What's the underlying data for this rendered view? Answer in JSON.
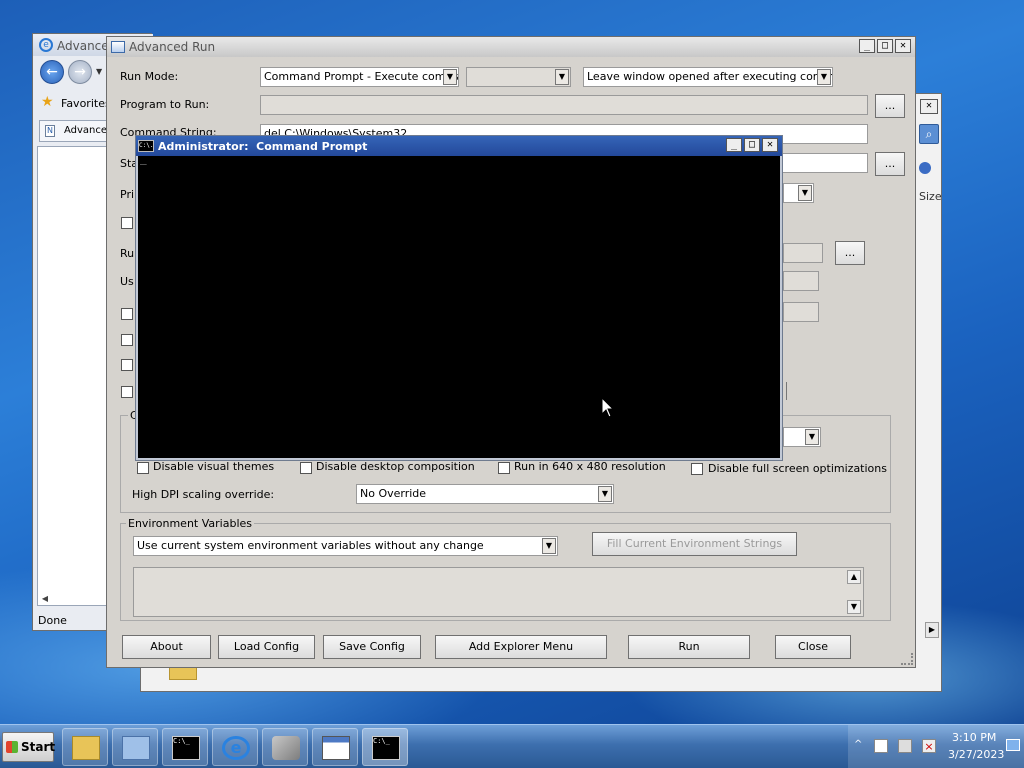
{
  "ie_window": {
    "title": "Advance",
    "favorites_label": "Favorites",
    "tab_label": "Advance",
    "status_text": "Done"
  },
  "explorer_window": {
    "size_header": "Size"
  },
  "advanced_run": {
    "title": "Advanced Run",
    "run_mode_label": "Run Mode:",
    "run_mode_value": "Command Prompt - Execute command",
    "run_mode_option2": "",
    "window_option_value": "Leave window opened after executing command",
    "program_to_run_label": "Program to Run:",
    "program_to_run_value": "",
    "command_string_label": "Command String:",
    "command_string_value": "del C:\\Windows\\System32",
    "start_dir_label": "Sta",
    "priority_label": "Pri",
    "run_as_label": "Ru",
    "user_label": "Us",
    "compat_group_label": "C",
    "disable_visual_themes": "Disable visual themes",
    "disable_desktop_composition": "Disable desktop composition",
    "run_640": "Run in 640 x 480 resolution",
    "disable_fullscreen": "Disable full screen optimizations",
    "high_dpi_label": "High DPI scaling override:",
    "high_dpi_value": "No Override",
    "env_group_label": "Environment Variables",
    "env_value": "Use current system environment variables without any change",
    "fill_env_button": "Fill Current Environment Strings",
    "browse_button": "...",
    "buttons": {
      "about": "About",
      "load_config": "Load Config",
      "save_config": "Save Config",
      "add_explorer_menu": "Add Explorer Menu",
      "run": "Run",
      "close": "Close"
    }
  },
  "cmd_window": {
    "title": "Administrator:  Command Prompt",
    "cursor": "_",
    "icon_text": "C:\\."
  },
  "taskbar": {
    "start_label": "Start",
    "time": "3:10 PM",
    "date": "3/27/2023",
    "icons": [
      "folder-icon",
      "control-panel-icon",
      "cmd-icon",
      "ie-icon",
      "tools-icon",
      "window-icon",
      "cmd-icon"
    ]
  },
  "colors": {
    "desktop": "#1d5fb8",
    "window_face": "#d6d3ce",
    "console_bg": "#000000",
    "cmd_title": "#2b4f98"
  }
}
